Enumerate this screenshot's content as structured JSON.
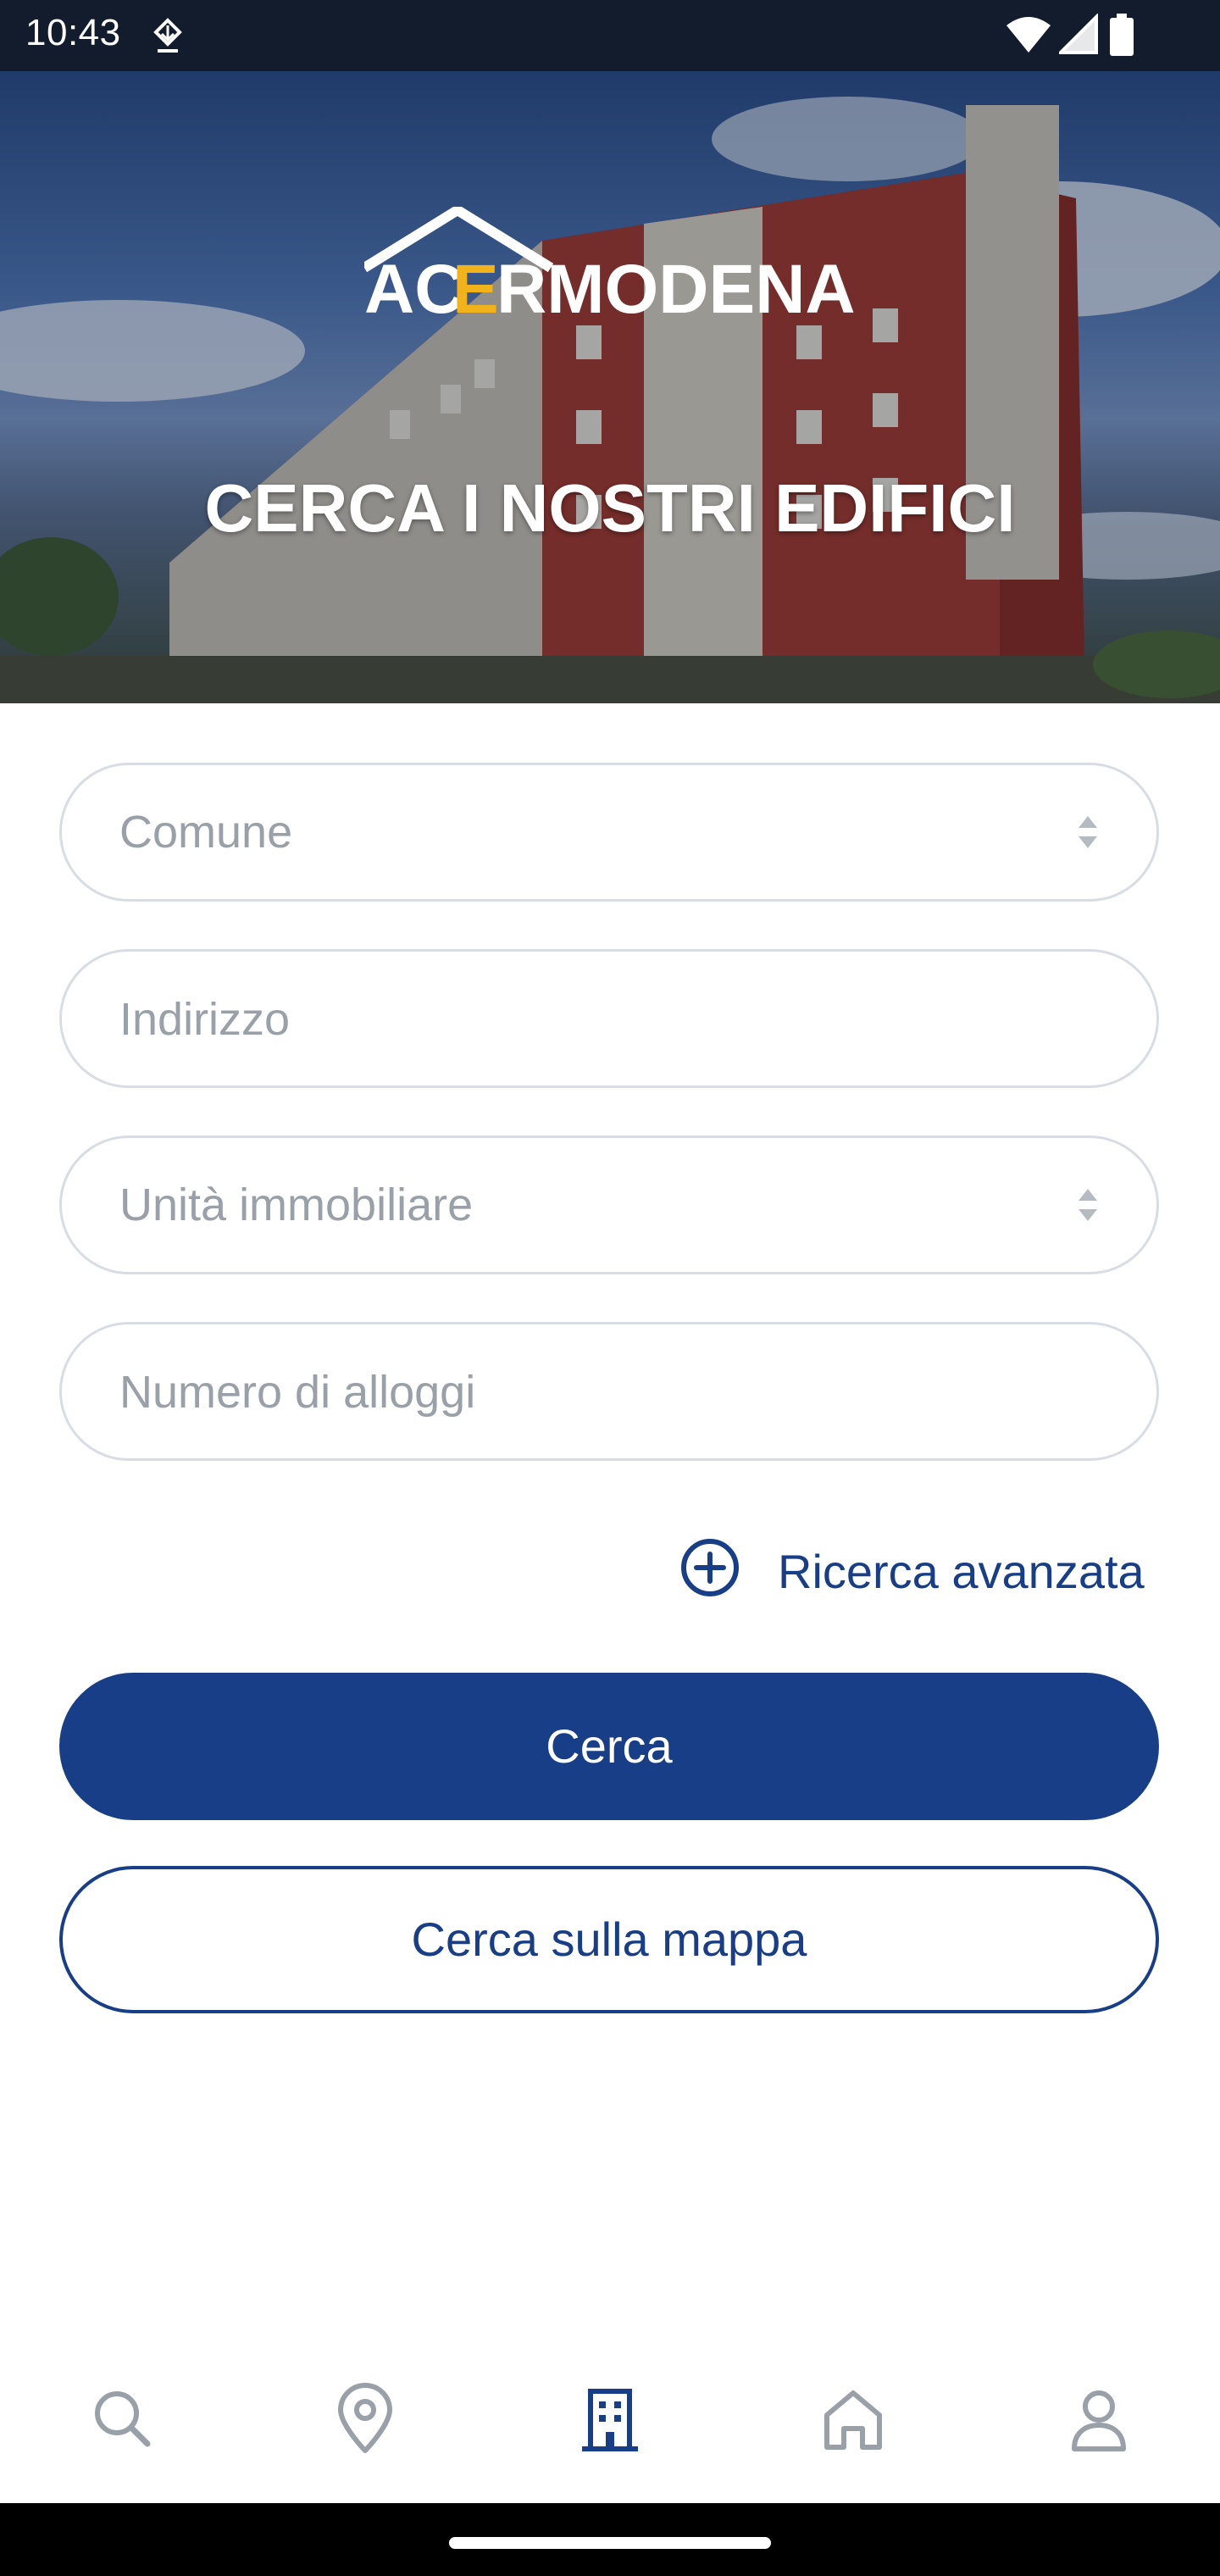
{
  "status_bar": {
    "time": "10:43"
  },
  "hero": {
    "logo_text": "ACERMODENA",
    "title": "CERCA I NOSTRI EDIFICI"
  },
  "form": {
    "comune_placeholder": "Comune",
    "indirizzo_placeholder": "Indirizzo",
    "unita_placeholder": "Unità immobiliare",
    "alloggi_placeholder": "Numero di alloggi",
    "advanced_search_label": "Ricerca avanzata",
    "search_button_label": "Cerca",
    "map_search_button_label": "Cerca sulla mappa"
  },
  "bottom_nav": {
    "items": [
      {
        "icon": "search-icon",
        "active": false
      },
      {
        "icon": "map-pin-icon",
        "active": false
      },
      {
        "icon": "building-icon",
        "active": true
      },
      {
        "icon": "home-icon",
        "active": false
      },
      {
        "icon": "user-icon",
        "active": false
      }
    ]
  },
  "colors": {
    "brand_blue": "#173e86",
    "logo_accent": "#f2b21b",
    "inactive_icon": "#9aa0a8",
    "field_border": "#d8dce3"
  }
}
